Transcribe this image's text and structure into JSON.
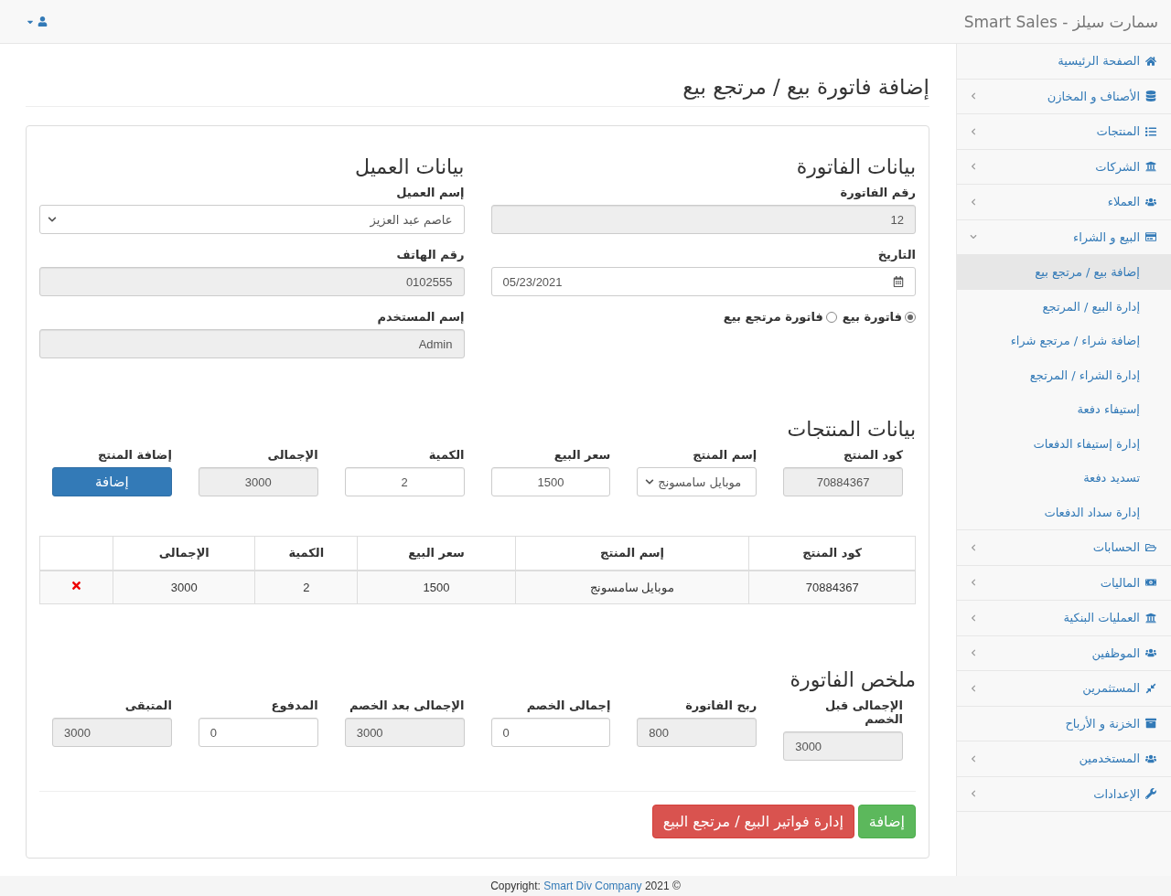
{
  "navbar": {
    "brand": "سمارت سيلز - Smart Sales"
  },
  "sidebar": {
    "items": [
      {
        "label": "الصفحة الرئيسية",
        "kind": "link"
      },
      {
        "label": "الأصناف و المخازن",
        "kind": "menu",
        "expanded": false
      },
      {
        "label": "المنتجات",
        "kind": "menu",
        "expanded": false
      },
      {
        "label": "الشركات",
        "kind": "menu",
        "expanded": false
      },
      {
        "label": "العملاء",
        "kind": "menu",
        "expanded": false
      },
      {
        "label": "البيع و الشراء",
        "kind": "menu",
        "expanded": true,
        "children": [
          {
            "label": "إضافة بيع / مرتجع بيع",
            "selected": true
          },
          {
            "label": "إدارة البيع / المرتجع",
            "selected": false
          },
          {
            "label": "إضافة شراء / مرتجع شراء",
            "selected": false
          },
          {
            "label": "إدارة الشراء / المرتجع",
            "selected": false
          },
          {
            "label": "إستيفاء دفعة",
            "selected": false
          },
          {
            "label": "إدارة إستيفاء الدفعات",
            "selected": false
          },
          {
            "label": "تسديد دفعة",
            "selected": false
          },
          {
            "label": "إدارة سداد الدفعات",
            "selected": false
          }
        ]
      },
      {
        "label": "الحسابات",
        "kind": "menu",
        "expanded": false
      },
      {
        "label": "الماليات",
        "kind": "menu",
        "expanded": false
      },
      {
        "label": "العمليات البنكية",
        "kind": "menu",
        "expanded": false
      },
      {
        "label": "الموظفين",
        "kind": "menu",
        "expanded": false
      },
      {
        "label": "المستثمرين",
        "kind": "menu",
        "expanded": false
      },
      {
        "label": "الخزنة و الأرباح",
        "kind": "link"
      },
      {
        "label": "المستخدمين",
        "kind": "menu",
        "expanded": false
      },
      {
        "label": "الإعدادات",
        "kind": "menu",
        "expanded": false
      }
    ]
  },
  "page_title": "إضافة فاتورة بيع / مرتجع بيع",
  "invoice": {
    "heading": "بيانات الفاتورة",
    "fields": [
      {
        "label": "رقم الفاتورة",
        "value": "12",
        "kind": "readonly"
      },
      {
        "label": "التاريخ",
        "value": "05/23/2021",
        "kind": "date"
      }
    ],
    "invoice_type": [
      {
        "label": "فاتورة بيع",
        "selected": true
      },
      {
        "label": "فاتورة مرتجع بيع",
        "selected": false
      }
    ]
  },
  "customer": {
    "heading": "بيانات العميل",
    "fields": [
      {
        "label": "إسم العميل",
        "value": "عاصم عبد العزيز",
        "kind": "select"
      },
      {
        "label": "رقم الهاتف",
        "value": "0102555",
        "kind": "readonly"
      },
      {
        "label": "إسم المستخدم",
        "value": "Admin",
        "kind": "readonly"
      }
    ]
  },
  "products": {
    "heading": "بيانات المنتجات",
    "fields": [
      {
        "label": "كود المنتج",
        "value": "70884367",
        "kind": "readonly"
      },
      {
        "label": "إسم المنتج",
        "value": "موبايل سامسونج",
        "kind": "select"
      },
      {
        "label": "سعر البيع",
        "value": "1500",
        "kind": "input"
      },
      {
        "label": "الكمية",
        "value": "2",
        "kind": "input"
      },
      {
        "label": "الإجمالى",
        "value": "3000",
        "kind": "readonly"
      },
      {
        "label": "إضافة المنتج",
        "value": "إضافة",
        "kind": "button"
      }
    ]
  },
  "table": {
    "columns": [
      "كود المنتج",
      "إسم المنتج",
      "سعر البيع",
      "الكمية",
      "الإجمالى"
    ],
    "rows": [
      {
        "cells": [
          "70884367",
          "موبايل سامسونج",
          "1500",
          "2",
          "3000"
        ]
      }
    ]
  },
  "summary": {
    "heading": "ملخص الفاتورة",
    "fields": [
      {
        "label": "الإجمالى قبل الخصم",
        "value": "3000",
        "kind": "readonly"
      },
      {
        "label": "ربح الفاتورة",
        "value": "800",
        "kind": "readonly"
      },
      {
        "label": "إجمالى الخصم",
        "value": "0",
        "kind": "input"
      },
      {
        "label": "الإجمالى بعد الخصم",
        "value": "3000",
        "kind": "readonly"
      },
      {
        "label": "المدفوع",
        "value": "0",
        "kind": "input"
      },
      {
        "label": "المتبقى",
        "value": "3000",
        "kind": "readonly"
      }
    ]
  },
  "actions": [
    {
      "label": "إضافة",
      "kind": "success"
    },
    {
      "label": "إدارة فواتير البيع / مرتجع البيع",
      "kind": "danger"
    }
  ],
  "footer": {
    "prefix": "Copyright:",
    "link": "Smart Div Company",
    "suffix": "2021 ©"
  }
}
